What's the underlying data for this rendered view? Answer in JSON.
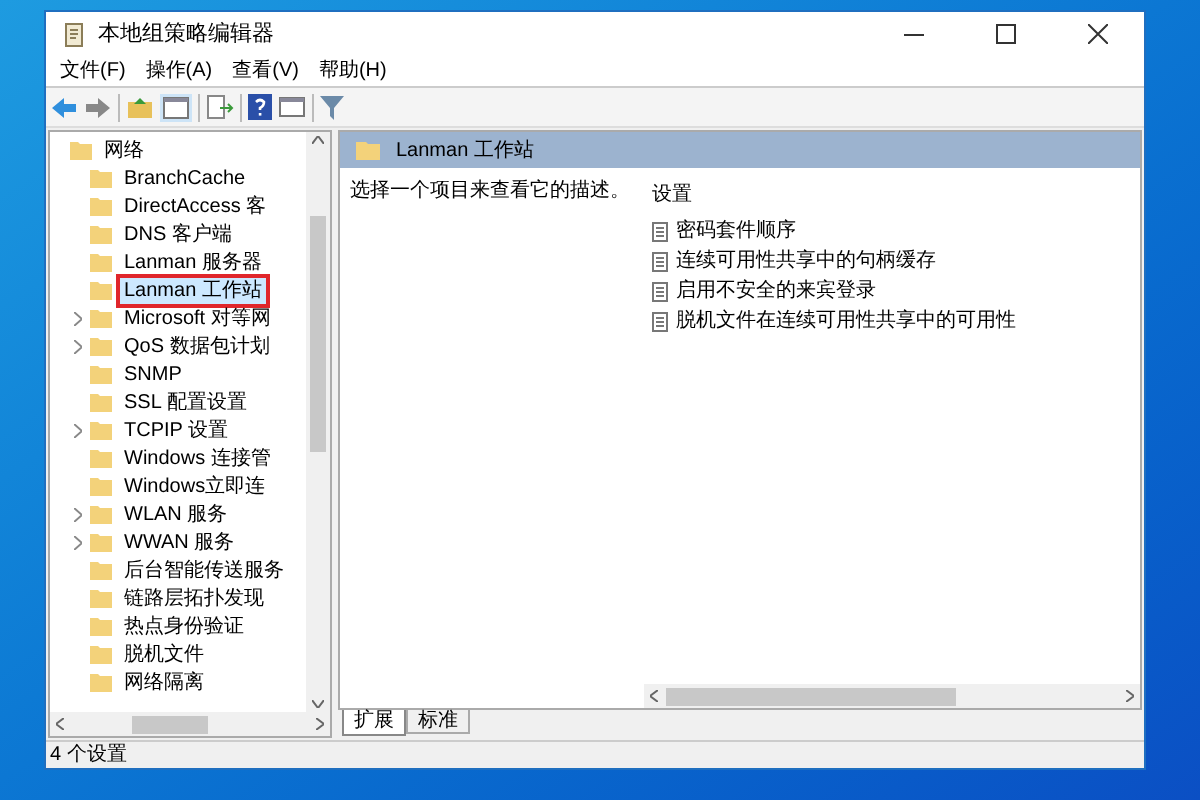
{
  "window": {
    "title": "本地组策略编辑器"
  },
  "menu": [
    "文件(F)",
    "操作(A)",
    "查看(V)",
    "帮助(H)"
  ],
  "tree": {
    "label": "网络",
    "children": [
      {
        "label": "BranchCache",
        "expandable": false,
        "selected": false
      },
      {
        "label": "DirectAccess 客",
        "expandable": false,
        "selected": false
      },
      {
        "label": "DNS 客户端",
        "expandable": false,
        "selected": false
      },
      {
        "label": "Lanman 服务器",
        "expandable": false,
        "selected": false
      },
      {
        "label": "Lanman 工作站",
        "expandable": false,
        "selected": true
      },
      {
        "label": "Microsoft 对等网",
        "expandable": true,
        "selected": false
      },
      {
        "label": "QoS 数据包计划",
        "expandable": true,
        "selected": false
      },
      {
        "label": "SNMP",
        "expandable": false,
        "selected": false
      },
      {
        "label": "SSL 配置设置",
        "expandable": false,
        "selected": false
      },
      {
        "label": "TCPIP 设置",
        "expandable": true,
        "selected": false
      },
      {
        "label": "Windows 连接管",
        "expandable": false,
        "selected": false
      },
      {
        "label": "Windows立即连",
        "expandable": false,
        "selected": false
      },
      {
        "label": "WLAN 服务",
        "expandable": true,
        "selected": false
      },
      {
        "label": "WWAN 服务",
        "expandable": true,
        "selected": false
      },
      {
        "label": "后台智能传送服务",
        "expandable": false,
        "selected": false
      },
      {
        "label": "链路层拓扑发现",
        "expandable": false,
        "selected": false
      },
      {
        "label": "热点身份验证",
        "expandable": false,
        "selected": false
      },
      {
        "label": "脱机文件",
        "expandable": false,
        "selected": false
      },
      {
        "label": "网络隔离",
        "expandable": false,
        "selected": false
      }
    ]
  },
  "details": {
    "header": "Lanman 工作站",
    "description": "选择一个项目来查看它的描述。",
    "column": "设置",
    "settings": [
      "密码套件顺序",
      "连续可用性共享中的句柄缓存",
      "启用不安全的来宾登录",
      "脱机文件在连续可用性共享中的可用性"
    ]
  },
  "tabs": [
    {
      "label": "扩展",
      "selected": true
    },
    {
      "label": "标准",
      "selected": false
    }
  ],
  "status_bar": "4 个设置"
}
